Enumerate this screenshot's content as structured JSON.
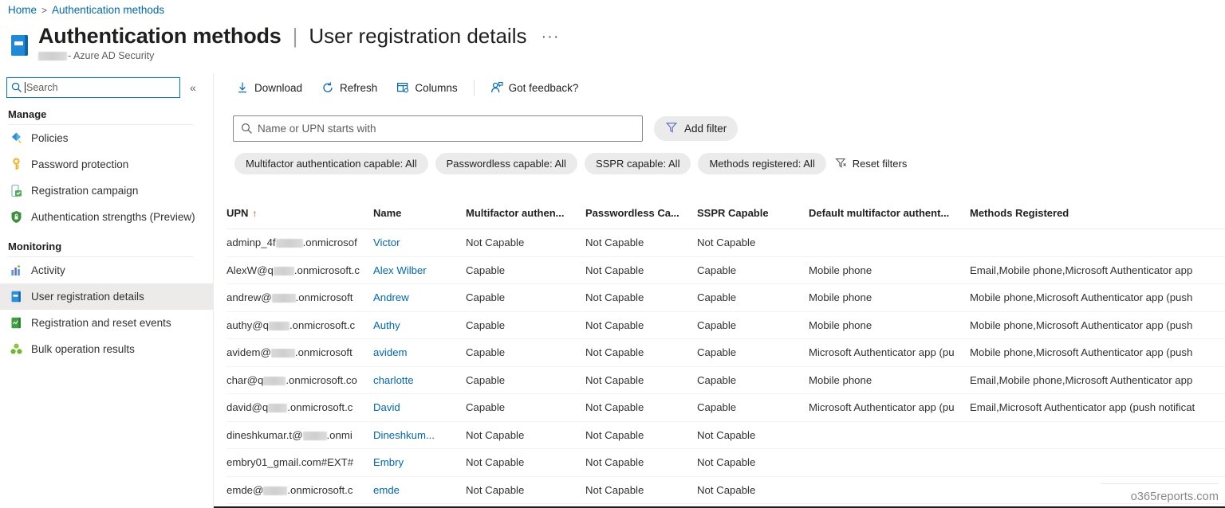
{
  "breadcrumb": {
    "home": "Home",
    "separator": ">",
    "current": "Authentication methods"
  },
  "header": {
    "title_main": "Authentication methods",
    "title_separator": "|",
    "title_sub": "User registration details",
    "overflow_label": "···",
    "subtitle_suffix": "- Azure AD Security",
    "icon": "blade-book-icon"
  },
  "sidebar": {
    "search_placeholder": "Search",
    "collapse_label": "«",
    "sections": [
      {
        "title": "Manage",
        "items": [
          {
            "label": "Policies",
            "icon": "policies-icon",
            "selected": false
          },
          {
            "label": "Password protection",
            "icon": "key-icon",
            "selected": false
          },
          {
            "label": "Registration campaign",
            "icon": "mobile-registration-icon",
            "selected": false
          },
          {
            "label": "Authentication strengths (Preview)",
            "icon": "shield-lock-icon",
            "selected": false
          }
        ]
      },
      {
        "title": "Monitoring",
        "items": [
          {
            "label": "Activity",
            "icon": "bar-chart-icon",
            "selected": false
          },
          {
            "label": "User registration details",
            "icon": "blade-book-icon",
            "selected": true
          },
          {
            "label": "Registration and reset events",
            "icon": "events-book-icon",
            "selected": false
          },
          {
            "label": "Bulk operation results",
            "icon": "bulk-operations-icon",
            "selected": false
          }
        ]
      }
    ]
  },
  "toolbar": {
    "items": [
      {
        "label": "Download",
        "icon": "download-icon"
      },
      {
        "label": "Refresh",
        "icon": "refresh-icon"
      },
      {
        "label": "Columns",
        "icon": "columns-icon"
      }
    ],
    "feedback": {
      "label": "Got feedback?",
      "icon": "feedback-person-icon"
    }
  },
  "filters": {
    "search_placeholder": "Name or UPN starts with",
    "search_value": "",
    "add_filter_label": "Add filter",
    "add_filter_icon": "funnel-icon",
    "pills": [
      "Multifactor authentication capable: All",
      "Passwordless capable: All",
      "SSPR capable: All",
      "Methods registered: All"
    ],
    "reset_label": "Reset filters",
    "reset_icon": "funnel-clear-icon"
  },
  "table": {
    "sort_column": "UPN",
    "sort_direction_glyph": "↑",
    "columns": [
      "UPN",
      "Name",
      "Multifactor authen...",
      "Passwordless Ca...",
      "SSPR Capable",
      "Default multifactor authent...",
      "Methods Registered"
    ],
    "rows": [
      {
        "upn_prefix": "adminp_4f",
        "upn_suffix": ".onmicrosof",
        "name": "Victor",
        "mfa": "Not Capable",
        "passwordless": "Not Capable",
        "sspr": "Not Capable",
        "default_method": "",
        "methods": ""
      },
      {
        "upn_prefix": "AlexW@q",
        "upn_suffix": ".onmicrosoft.c",
        "name": "Alex Wilber",
        "mfa": "Capable",
        "passwordless": "Not Capable",
        "sspr": "Capable",
        "default_method": "Mobile phone",
        "methods": "Email,Mobile phone,Microsoft Authenticator app"
      },
      {
        "upn_prefix": "andrew@",
        "upn_suffix": ".onmicrosoft",
        "name": "Andrew",
        "mfa": "Capable",
        "passwordless": "Not Capable",
        "sspr": "Capable",
        "default_method": "Mobile phone",
        "methods": "Mobile phone,Microsoft Authenticator app (push"
      },
      {
        "upn_prefix": "authy@q",
        "upn_suffix": ".onmicrosoft.c",
        "name": "Authy",
        "mfa": "Capable",
        "passwordless": "Not Capable",
        "sspr": "Capable",
        "default_method": "Mobile phone",
        "methods": "Mobile phone,Microsoft Authenticator app (push"
      },
      {
        "upn_prefix": "avidem@",
        "upn_suffix": ".onmicrosoft",
        "name": "avidem",
        "mfa": "Capable",
        "passwordless": "Not Capable",
        "sspr": "Capable",
        "default_method": "Microsoft Authenticator app (pu",
        "methods": "Mobile phone,Microsoft Authenticator app (push"
      },
      {
        "upn_prefix": "char@q",
        "upn_suffix": ".onmicrosoft.co",
        "name": "charlotte",
        "mfa": "Capable",
        "passwordless": "Not Capable",
        "sspr": "Capable",
        "default_method": "Mobile phone",
        "methods": "Email,Mobile phone,Microsoft Authenticator app"
      },
      {
        "upn_prefix": "david@q",
        "upn_suffix": ".onmicrosoft.c",
        "name": "David",
        "mfa": "Capable",
        "passwordless": "Not Capable",
        "sspr": "Capable",
        "default_method": "Microsoft Authenticator app (pu",
        "methods": "Email,Microsoft Authenticator app (push notificat"
      },
      {
        "upn_prefix": "dineshkumar.t@",
        "upn_suffix": ".onmi",
        "name": "Dineshkum...",
        "mfa": "Not Capable",
        "passwordless": "Not Capable",
        "sspr": "Not Capable",
        "default_method": "",
        "methods": ""
      },
      {
        "upn_prefix": "embry01_gmail.com#EXT#",
        "upn_suffix": "",
        "name": "Embry",
        "mfa": "Not Capable",
        "passwordless": "Not Capable",
        "sspr": "Not Capable",
        "default_method": "",
        "methods": ""
      },
      {
        "upn_prefix": "emde@",
        "upn_suffix": ".onmicrosoft.c",
        "name": "emde",
        "mfa": "Not Capable",
        "passwordless": "Not Capable",
        "sspr": "Not Capable",
        "default_method": "",
        "methods": ""
      }
    ]
  },
  "watermark": {
    "text": "o365reports.com"
  },
  "colors": {
    "link": "#0067b8",
    "accent": "#0078d4",
    "sort_arrow": "#d83b01",
    "pill_bg": "#ebebeb",
    "selected_nav": "#edebe9"
  }
}
